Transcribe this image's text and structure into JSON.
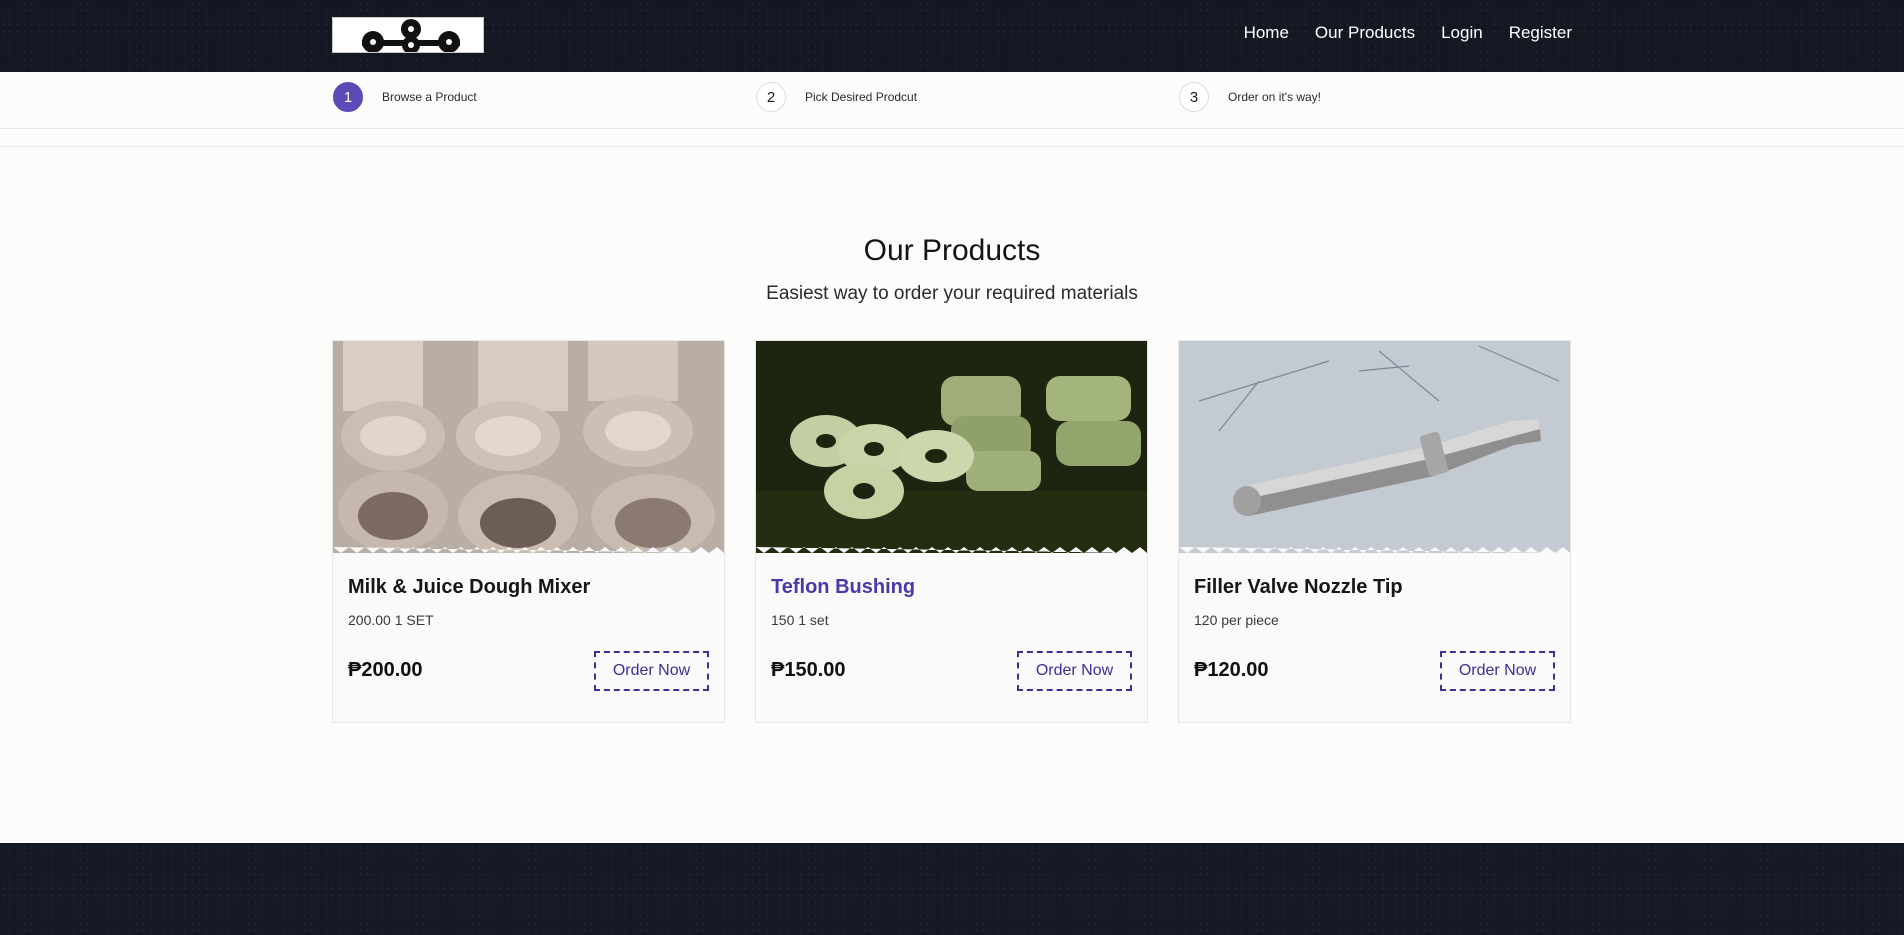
{
  "header": {
    "nav": [
      {
        "label": "Home"
      },
      {
        "label": "Our Products"
      },
      {
        "label": "Login"
      },
      {
        "label": "Register"
      }
    ]
  },
  "steps": [
    {
      "num": "1",
      "label": "Browse a Product",
      "active": true
    },
    {
      "num": "2",
      "label": "Pick Desired Prodcut",
      "active": false
    },
    {
      "num": "3",
      "label": "Order on it's way!",
      "active": false
    }
  ],
  "section": {
    "title": "Our Products",
    "subtitle": "Easiest way to order your required materials"
  },
  "products": [
    {
      "name": "Milk & Juice Dough Mixer",
      "desc": "200.00 1 SET",
      "price": "₱200.00",
      "button": "Order Now"
    },
    {
      "name": "Teflon Bushing",
      "desc": "150 1 set",
      "price": "₱150.00",
      "button": "Order Now"
    },
    {
      "name": "Filler Valve Nozzle Tip",
      "desc": "120 per piece",
      "price": "₱120.00",
      "button": "Order Now"
    }
  ],
  "colors": {
    "header_bg": "#121722",
    "accent": "#5b4ab8",
    "button_border": "#3d2f96",
    "link": "#4a3aa8"
  }
}
